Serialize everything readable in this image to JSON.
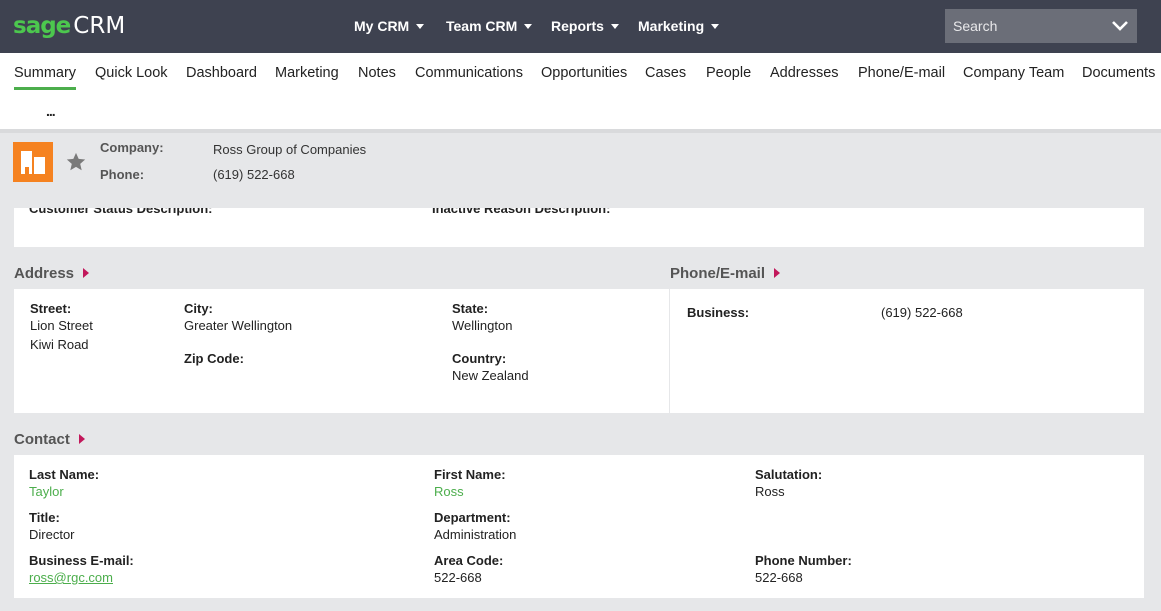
{
  "app": {
    "logo_sage": "sage",
    "logo_crm": "CRM"
  },
  "topnav": [
    {
      "label": "My CRM"
    },
    {
      "label": "Team CRM"
    },
    {
      "label": "Reports"
    },
    {
      "label": "Marketing"
    }
  ],
  "search": {
    "placeholder": "Search"
  },
  "tabs": [
    {
      "label": "Summary",
      "active": true
    },
    {
      "label": "Quick Look"
    },
    {
      "label": "Dashboard"
    },
    {
      "label": "Marketing"
    },
    {
      "label": "Notes"
    },
    {
      "label": "Communications"
    },
    {
      "label": "Opportunities"
    },
    {
      "label": "Cases"
    },
    {
      "label": "People"
    },
    {
      "label": "Addresses"
    },
    {
      "label": "Phone/E-mail"
    },
    {
      "label": "Company Team"
    },
    {
      "label": "Documents"
    }
  ],
  "more_tabs": "...",
  "header": {
    "company_label": "Company:",
    "company_value": "Ross Group of Companies",
    "phone_label": "Phone:",
    "phone_value": "(619) 522-668"
  },
  "status_panel": {
    "customer_status_label": "Customer Status Description:",
    "inactive_reason_label": "Inactive Reason Description:"
  },
  "address": {
    "title": "Address",
    "street_label": "Street:",
    "street_line1": "Lion Street",
    "street_line2": "Kiwi Road",
    "city_label": "City:",
    "city_value": "Greater Wellington",
    "zip_label": "Zip Code:",
    "state_label": "State:",
    "state_value": "Wellington",
    "country_label": "Country:",
    "country_value": "New Zealand"
  },
  "phone_email": {
    "title": "Phone/E-mail",
    "business_label": "Business:",
    "business_value": "(619) 522-668"
  },
  "contact": {
    "title": "Contact",
    "last_name_label": "Last Name:",
    "last_name_value": "Taylor",
    "first_name_label": "First Name:",
    "first_name_value": "Ross",
    "salutation_label": "Salutation:",
    "salutation_value": "Ross",
    "title_label": "Title:",
    "title_value": "Director",
    "department_label": "Department:",
    "department_value": "Administration",
    "email_label": "Business E-mail:",
    "email_value": "ross@rgc.com",
    "area_code_label": "Area Code:",
    "area_code_value": "522-668",
    "phone_number_label": "Phone Number:",
    "phone_number_value": "522-668"
  },
  "colors": {
    "topbar": "#3e4250",
    "brand_green": "#4cc74e",
    "link_green": "#4cae4c",
    "entity_orange": "#f58220",
    "section_arrow": "#c2185b",
    "page_bg": "#e6e7e9"
  },
  "icons": [
    "building-icon",
    "star-icon",
    "chevron-down-icon",
    "caret-down-icon",
    "section-arrow-icon"
  ]
}
